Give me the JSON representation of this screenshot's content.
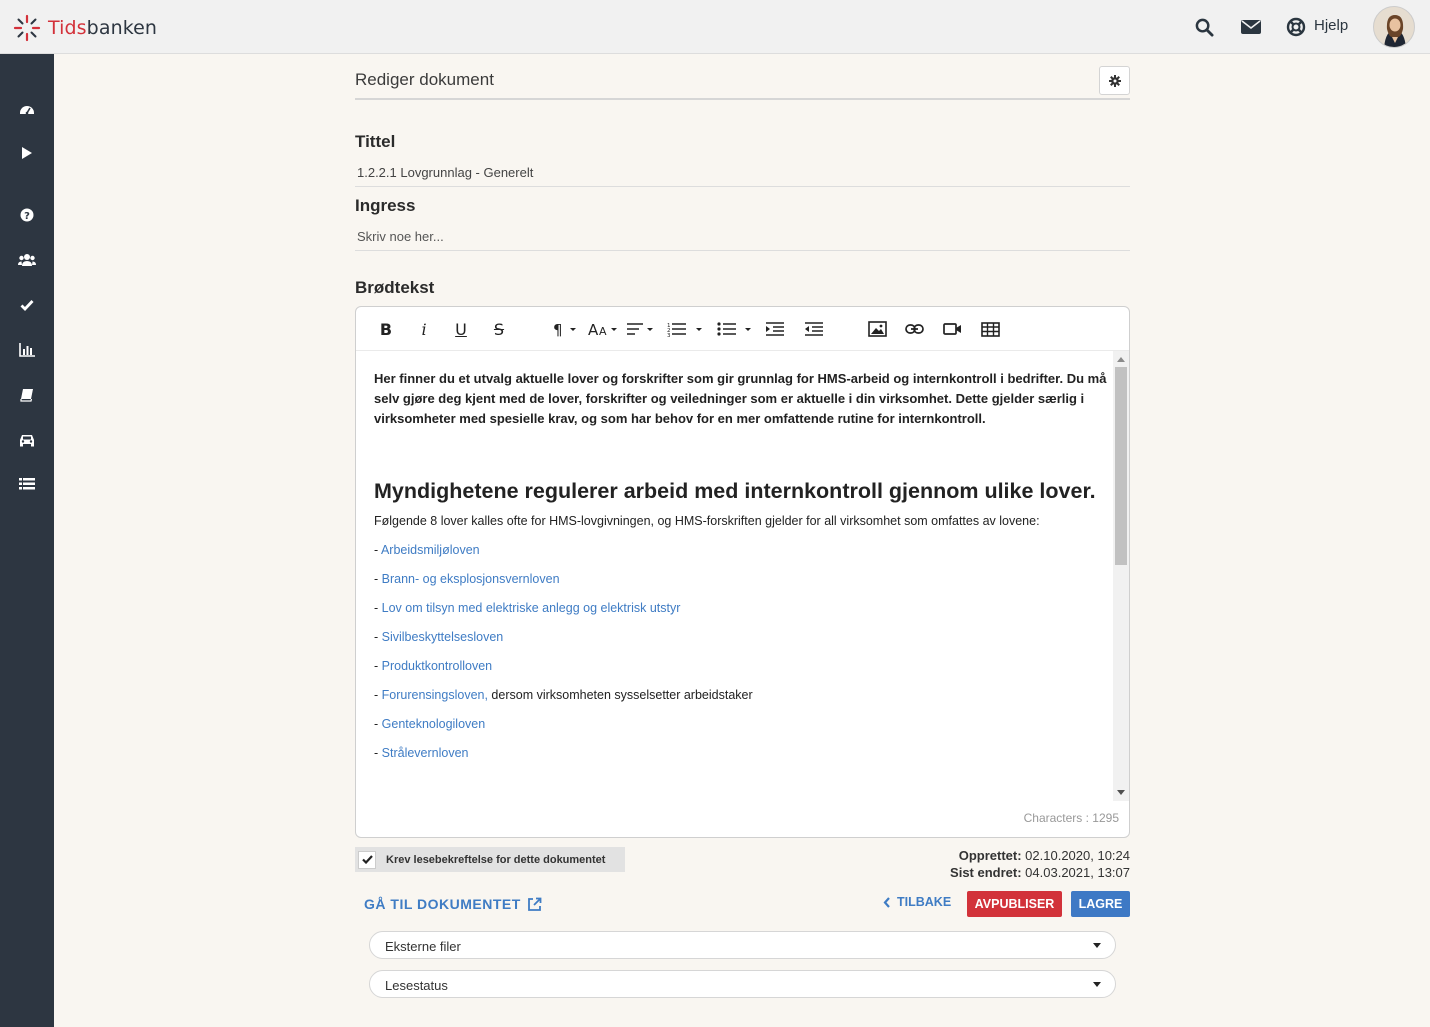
{
  "app": {
    "brand_part1": "Tids",
    "brand_part2": "banken",
    "help_label": "Hjelp",
    "icons": [
      "search-icon",
      "envelope-icon",
      "lifebuoy-icon"
    ]
  },
  "sidebar": {
    "items": [
      {
        "name": "dashboard-icon"
      },
      {
        "name": "play-icon"
      },
      {
        "name": "question-icon"
      },
      {
        "name": "users-icon"
      },
      {
        "name": "check-icon"
      },
      {
        "name": "bar-chart-icon"
      },
      {
        "name": "book-icon"
      },
      {
        "name": "car-icon"
      },
      {
        "name": "list-icon"
      }
    ]
  },
  "page": {
    "title": "Rediger dokument"
  },
  "form": {
    "title_label": "Tittel",
    "title_value": "1.2.2.1 Lovgrunnlag - Generelt",
    "ingress_label": "Ingress",
    "ingress_placeholder": "Skriv noe her...",
    "body_label": "Brødtekst"
  },
  "editor": {
    "toolbar": [
      "bold",
      "italic",
      "underline",
      "strikethrough",
      "paragraph-format",
      "font-size",
      "align",
      "ordered-list",
      "unordered-list",
      "outdent",
      "indent",
      "insert-image",
      "insert-link",
      "insert-video",
      "insert-table"
    ],
    "intro": "Her finner du et utvalg aktuelle lover og forskrifter som gir grunnlag for HMS-arbeid og internkontroll i bedrifter. Du må selv gjøre deg kjent med de lover, forskrifter og veiledninger som er aktuelle i din virksomhet. Dette gjelder særlig i virksomheter med spesielle krav, og som har behov for en mer omfattende rutine for internkontroll.",
    "heading": " Myndighetene regulerer arbeid med internkontroll gjennom ulike lover.",
    "lead": "Følgende 8 lover kalles ofte for HMS-lovgivningen, og HMS-forskriften gjelder for all virksomhet som omfattes av lovene:",
    "bullet_prefix": "- ",
    "laws": [
      {
        "link": "Arbeidsmiljøloven",
        "suffix": ""
      },
      {
        "link": "Brann- og eksplosjonsvernloven",
        "suffix": ""
      },
      {
        "link": "Lov om tilsyn med elektriske anlegg og elektrisk utstyr",
        "suffix": ""
      },
      {
        "link": "Sivilbeskyttelsesloven",
        "suffix": ""
      },
      {
        "link": "Produktkontrolloven",
        "suffix": ""
      },
      {
        "link": "Forurensingsloven,",
        "suffix": " dersom virksomheten sysselsetter arbeidstaker"
      },
      {
        "link": "Genteknologiloven",
        "suffix": ""
      },
      {
        "link": "Strålevernloven",
        "suffix": ""
      }
    ],
    "char_count": "Characters : 1295"
  },
  "footer": {
    "checkbox_label": "Krev lesebekreftelse for dette dokumentet",
    "checkbox_checked": true,
    "created_label": "Opprettet:",
    "created_value": " 02.10.2020, 10:24",
    "modified_label": "Sist endret:",
    "modified_value": " 04.03.2021, 13:07",
    "goto_label": "GÅ TIL DOKUMENTET",
    "back_label": "TILBAKE",
    "unpublish_label": "AVPUBLISER",
    "save_label": "LAGRE",
    "external_files_label": "Eksterne filer",
    "read_status_label": "Lesestatus"
  },
  "colors": {
    "sidebar": "#2d3641",
    "accent_blue": "#3e79c5",
    "accent_red": "#d2323a",
    "link": "#3f7cc4",
    "background": "#f9f6f1"
  }
}
